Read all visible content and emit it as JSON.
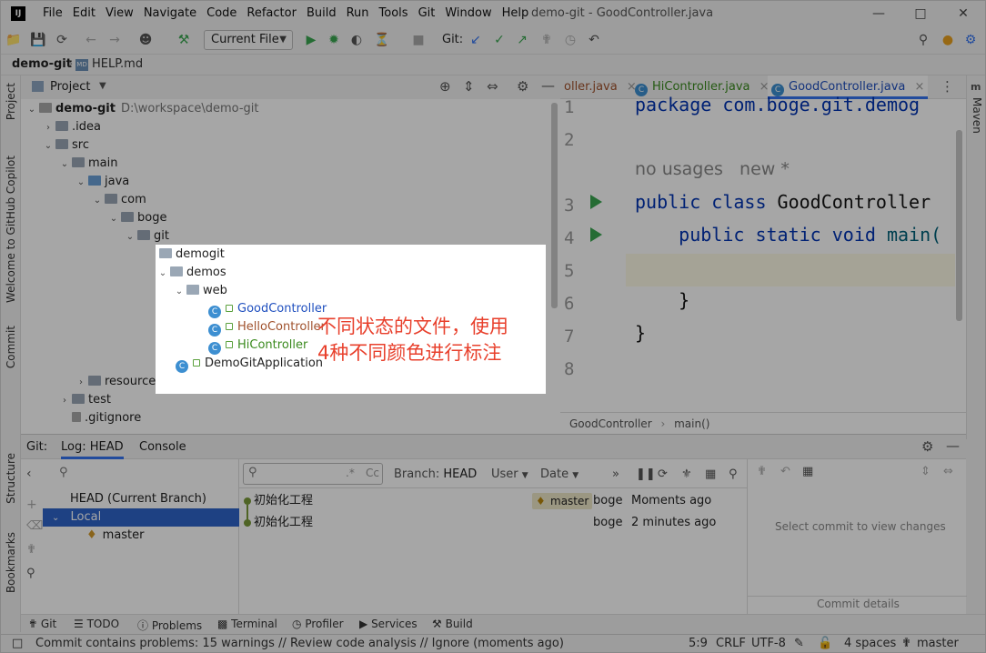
{
  "window": {
    "logo": "IJ",
    "title": "demo-git - GoodController.java",
    "menu": [
      "File",
      "Edit",
      "View",
      "Navigate",
      "Code",
      "Refactor",
      "Build",
      "Run",
      "Tools",
      "Git",
      "Window",
      "Help"
    ]
  },
  "toolbar": {
    "run_config": "Current File",
    "git_label": "Git:"
  },
  "navbar": {
    "project": "demo-git",
    "file": "HELP.md"
  },
  "left_stripe": {
    "project": "Project",
    "copilot": "Welcome to GitHub Copilot",
    "commit": "Commit",
    "structure": "Structure",
    "bookmarks": "Bookmarks"
  },
  "right_stripe": {
    "maven": "Maven"
  },
  "project_panel": {
    "title": "Project",
    "root_name": "demo-git",
    "root_path": "D:\\workspace\\demo-git",
    "tree": {
      "idea": ".idea",
      "src": "src",
      "main": "main",
      "java": "java",
      "com": "com",
      "boge": "boge",
      "git": "git",
      "resources": "resources",
      "test": "test",
      "gitignore": ".gitignore"
    }
  },
  "highlight": {
    "demogit": "demogit",
    "demos": "demos",
    "web": "web",
    "files": [
      {
        "name": "GoodController",
        "color": "#1f4fbf"
      },
      {
        "name": "HelloController",
        "color": "#a0522d"
      },
      {
        "name": "HiController",
        "color": "#3a8a1e"
      }
    ],
    "app": "DemoGitApplication",
    "annotation_line1": "不同状态的文件，使用",
    "annotation_line2": "4种不同颜色进行标注"
  },
  "editor": {
    "tabs": [
      "oller.java",
      "HiController.java",
      "GoodController.java"
    ],
    "line_numbers": [
      "1",
      "2",
      "3",
      "4",
      "5",
      "6",
      "7",
      "8"
    ],
    "line1": "package com.boge.git.demog",
    "hint_usage": "no usages   new *",
    "line3_kw": "public class",
    "line3_name": " GoodController",
    "line4_kw": "    public static void",
    "line4_name": " main(",
    "line6": "    }",
    "line7": "}",
    "breadcrumb_class": "GoodController",
    "breadcrumb_method": "main()"
  },
  "git_window": {
    "tab_git": "Git:",
    "tab_log": "Log: HEAD",
    "tab_console": "Console",
    "branches": {
      "head": "HEAD (Current Branch)",
      "local": "Local",
      "master": "master"
    },
    "filters": {
      "branch_label": "Branch:",
      "branch_value": "HEAD",
      "user": "User",
      "date": "Date"
    },
    "commits": [
      {
        "message": "初始化工程",
        "tag": "master",
        "author": "boge",
        "time": "Moments ago"
      },
      {
        "message": "初始化工程",
        "tag": "",
        "author": "boge",
        "time": "2 minutes ago"
      }
    ],
    "details_placeholder": "Select commit to view changes",
    "commit_details": "Commit details"
  },
  "bottom_tools": [
    "Git",
    "TODO",
    "Problems",
    "Terminal",
    "Profiler",
    "Services",
    "Build"
  ],
  "status": {
    "message": "Commit contains problems: 15 warnings // Review code analysis // Ignore (moments ago)",
    "position": "5:9",
    "line_sep": "CRLF",
    "encoding": "UTF-8",
    "indent": "4 spaces",
    "branch": "master"
  }
}
